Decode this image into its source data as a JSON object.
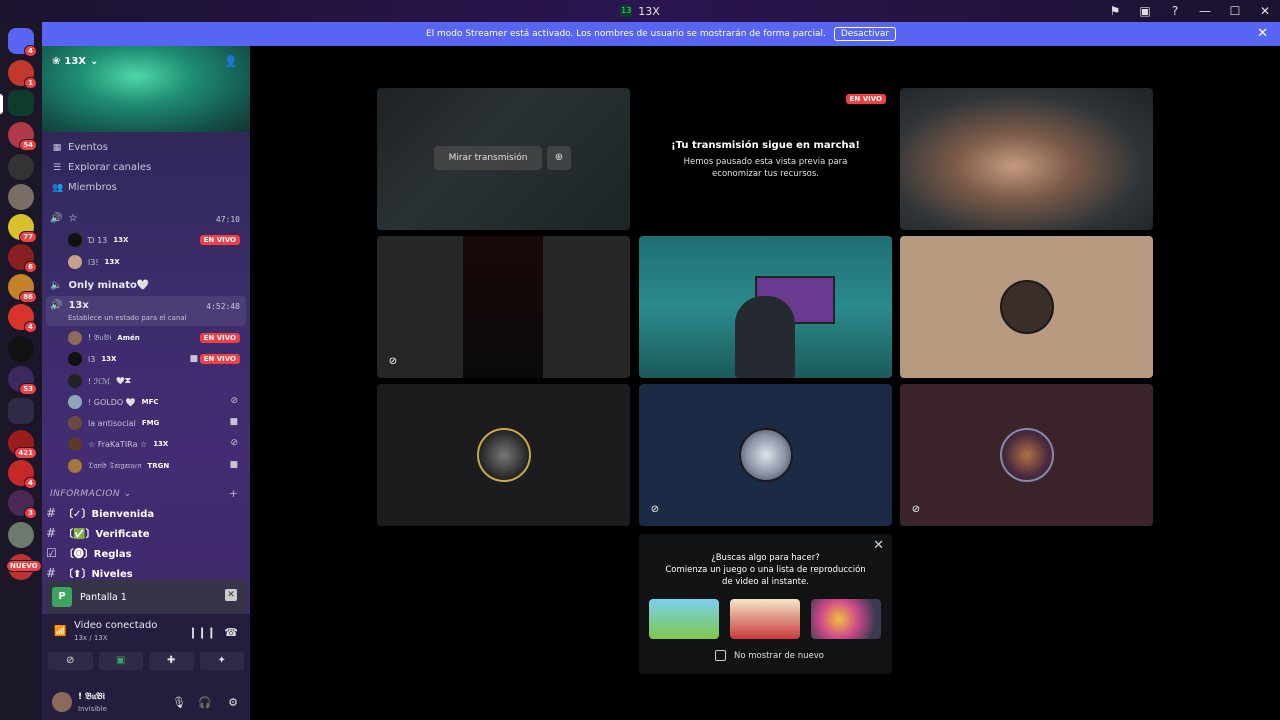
{
  "window": {
    "title": "13X"
  },
  "banner": {
    "text": "El modo Streamer está activado. Los nombres de usuario se mostrarán de forma parcial.",
    "button": "Desactivar"
  },
  "guild_badges": [
    "4",
    "1",
    "54",
    "77",
    "6",
    "86",
    "4",
    "53",
    "421",
    "4",
    "3",
    "NUEVO"
  ],
  "server": {
    "name": "13X",
    "nav": {
      "events": "Eventos",
      "explore": "Explorar canales",
      "members": "Miembros"
    }
  },
  "voice_channels": [
    {
      "name": "☆",
      "time": "47:10",
      "users": [
        {
          "name": "Ɗ 13",
          "tag": "13X",
          "live": "EN VIVO"
        },
        {
          "name": "l3!",
          "tag": "13X"
        }
      ]
    },
    {
      "name": "Only minato🤍"
    },
    {
      "name": "13x",
      "time": "4:52:48",
      "status": "Establece un estado para el canal",
      "users": [
        {
          "name": "! 𝔅𝔲𝔅𝔦",
          "tag": "Amén",
          "live": "EN VIVO"
        },
        {
          "name": "l3",
          "tag": "13X",
          "live": "EN VIVO"
        },
        {
          "name": "! ℋℳ",
          "tag": "🤍ⵣ"
        },
        {
          "name": "! GOLDO 🤍",
          "tag": "MFC"
        },
        {
          "name": "la antisocial",
          "tag": "FMG"
        },
        {
          "name": "☆ FraKaTIRa ☆",
          "tag": "13X"
        },
        {
          "name": "𝔇𝔞𝔳𝔦𝔡 𝔗𝔞𝔯𝔤𝔞𝔯𝔶𝔢𝔫",
          "tag": "TRGN"
        }
      ]
    }
  ],
  "category": {
    "name": "INFORMACION"
  },
  "text_channels": [
    {
      "name": "〔✓〕Bienvenida"
    },
    {
      "name": "〔✅〕Verificate"
    },
    {
      "name": "〔🅞〕Reglas"
    },
    {
      "name": "〔⬆〕Niveles"
    }
  ],
  "screen_share": {
    "label": "Pantalla 1"
  },
  "voice_panel": {
    "status": "Video conectado",
    "sub": "13x / 13X"
  },
  "me": {
    "name": "! 𝔅𝔲𝔅𝔦",
    "status": "Invisible"
  },
  "stream_tile": {
    "watch": "Mirar transmisión",
    "live": "EN VIVO",
    "title": "¡Tu transmisión sigue en marcha!",
    "body": "Hemos pausado esta vista previa para economizar tus recursos."
  },
  "activity_popup": {
    "title": "¿Buscas algo para hacer?",
    "body": "Comienza un juego o una lista de reproducción de video al instante.",
    "checkbox": "No mostrar de nuevo"
  }
}
